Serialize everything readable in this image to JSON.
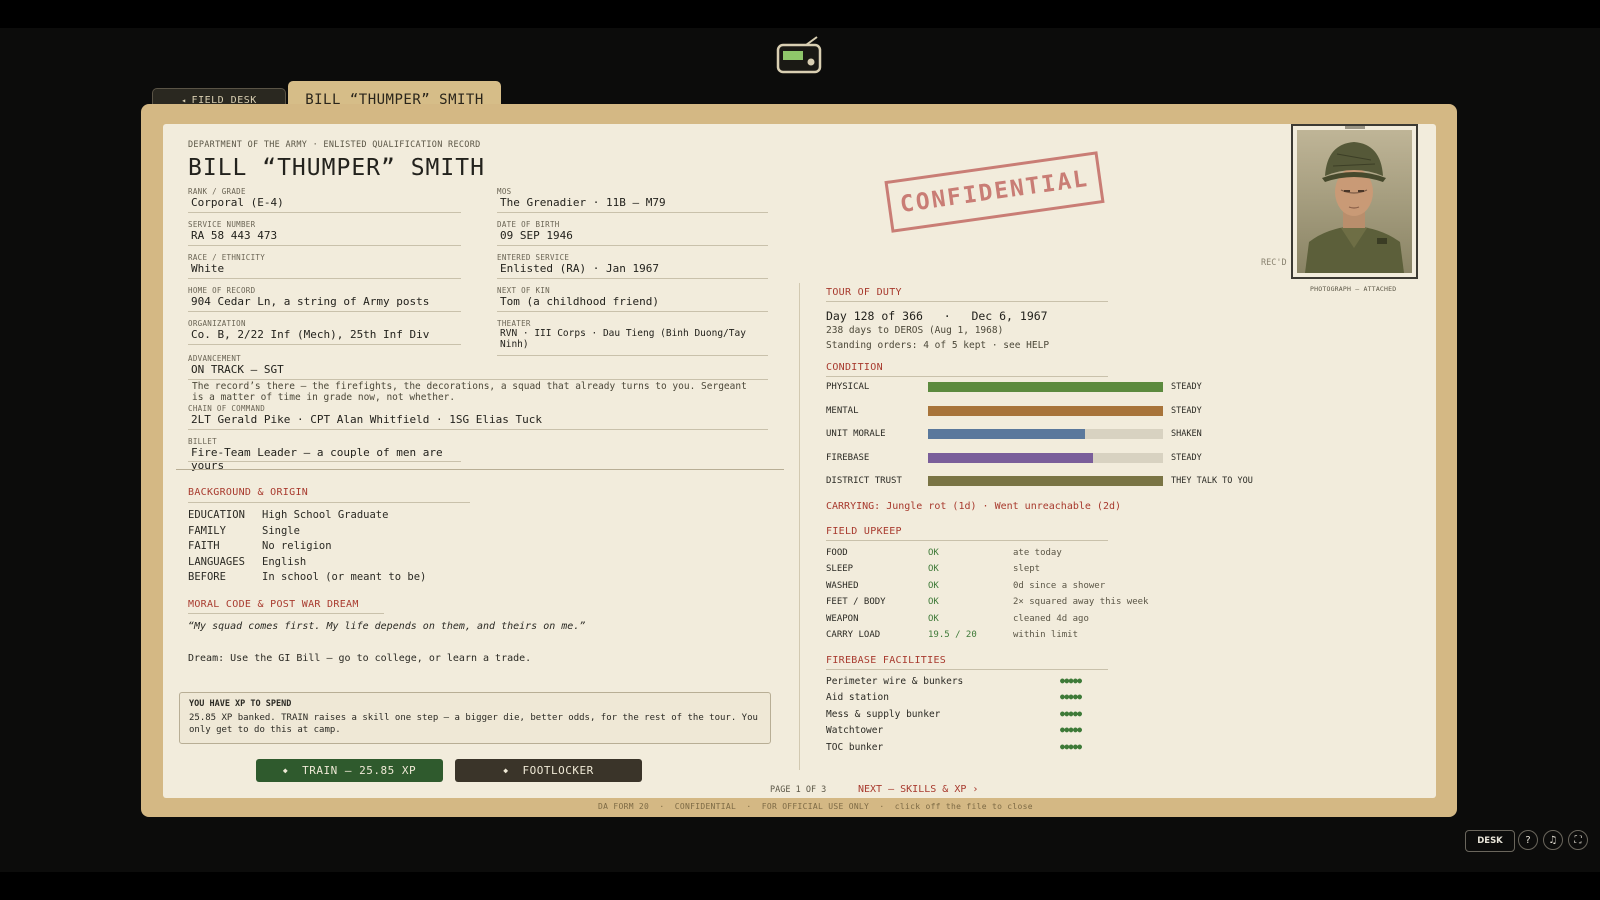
{
  "tabs": {
    "back_label": "FIELD DESK",
    "name_label": "BILL “THUMPER” SMITH"
  },
  "record": {
    "department": "DEPARTMENT OF THE ARMY · ENLISTED QUALIFICATION RECORD",
    "name": "BILL “THUMPER” SMITH",
    "fields": {
      "rank": {
        "label": "RANK / GRADE",
        "value": "Corporal (E-4)"
      },
      "mos": {
        "label": "MOS",
        "value": "The Grenadier · 11B — M79"
      },
      "service_number": {
        "label": "SERVICE NUMBER",
        "value": "RA 58 443 473"
      },
      "dob": {
        "label": "DATE OF BIRTH",
        "value": "09 SEP 1946"
      },
      "race": {
        "label": "RACE / ETHNICITY",
        "value": "White"
      },
      "entered": {
        "label": "ENTERED SERVICE",
        "value": "Enlisted (RA) · Jan 1967"
      },
      "home": {
        "label": "HOME OF RECORD",
        "value": "904 Cedar Ln, a string of Army posts"
      },
      "kin": {
        "label": "NEXT OF KIN",
        "value": "Tom (a childhood friend)"
      },
      "org": {
        "label": "ORGANIZATION",
        "value": "Co. B, 2/22 Inf (Mech), 25th Inf Div"
      },
      "theater": {
        "label": "THEATER",
        "value": "RVN · III Corps · Dau Tieng (Binh Duong/Tay Ninh)"
      },
      "advancement": {
        "label": "ADVANCEMENT",
        "value": "ON TRACK — SGT"
      },
      "chain": {
        "label": "CHAIN OF COMMAND",
        "value": "2LT Gerald Pike · CPT Alan Whitfield · 1SG Elias Tuck"
      },
      "billet": {
        "label": "BILLET",
        "value": "Fire-Team Leader — a couple of men are yours"
      }
    },
    "advancement_note": "The record’s there — the firefights, the decorations, a squad that already turns to you. Sergeant is a matter of time in grade now, not whether."
  },
  "background": {
    "title": "BACKGROUND & ORIGIN",
    "rows": [
      {
        "k": "EDUCATION",
        "v": "High School Graduate"
      },
      {
        "k": "FAMILY",
        "v": "Single"
      },
      {
        "k": "FAITH",
        "v": "No religion"
      },
      {
        "k": "LANGUAGES",
        "v": "English"
      },
      {
        "k": "BEFORE",
        "v": "In school (or meant to be)"
      }
    ]
  },
  "moral": {
    "title": "MORAL CODE & POST WAR DREAM",
    "quote": "“My squad comes first. My life depends on them, and theirs on me.”",
    "dream": "Dream: Use the GI Bill — go to college, or learn a trade."
  },
  "xp": {
    "heading": "YOU HAVE XP TO SPEND",
    "text": "25.85 XP banked. TRAIN raises a skill one step — a bigger die, better odds, for the rest of the tour. You only get to do this at camp."
  },
  "buttons": {
    "train": "TRAIN — 25.85 XP",
    "footlocker": "FOOTLOCKER",
    "diamond": "◆"
  },
  "pager": {
    "page": "PAGE 1 OF 3",
    "next": "NEXT — SKILLS & XP ›"
  },
  "footer": "DA FORM 20  ·  CONFIDENTIAL  ·  FOR OFFICIAL USE ONLY  ·  click off the file to close",
  "stamp": "CONFIDENTIAL",
  "photo": {
    "caption": "PHOTOGRAPH — ATTACHED",
    "recd": "REC'D"
  },
  "tour": {
    "title": "TOUR OF DUTY",
    "day": "Day 128 of 366",
    "date": "Dec 6, 1967",
    "sep": "·",
    "deros": "238 days to DEROS (Aug 1, 1968)",
    "orders": "Standing orders: 4 of 5 kept · see HELP"
  },
  "condition": {
    "title": "CONDITION",
    "rows": [
      {
        "k": "PHYSICAL",
        "status": "STEADY",
        "level": 1.0,
        "color": "#5c8a3e"
      },
      {
        "k": "MENTAL",
        "status": "STEADY",
        "level": 1.0,
        "color": "#a8743a"
      },
      {
        "k": "UNIT MORALE",
        "status": "SHAKEN",
        "level": 0.67,
        "color": "#5a789c"
      },
      {
        "k": "FIREBASE",
        "status": "STEADY",
        "level": 0.7,
        "color": "#7a5e9a"
      },
      {
        "k": "DISTRICT TRUST",
        "status": "THEY TALK TO YOU",
        "level": 1.0,
        "color": "#7a7444"
      }
    ],
    "carrying": "CARRYING: Jungle rot (1d) · Went unreachable (2d)"
  },
  "upkeep": {
    "title": "FIELD UPKEEP",
    "rows": [
      {
        "k": "FOOD",
        "v": "OK",
        "n": "ate today"
      },
      {
        "k": "SLEEP",
        "v": "OK",
        "n": "slept"
      },
      {
        "k": "WASHED",
        "v": "OK",
        "n": "0d since a shower"
      },
      {
        "k": "FEET / BODY",
        "v": "OK",
        "n": "2× squared away this week"
      },
      {
        "k": "WEAPON",
        "v": "OK",
        "n": "cleaned 4d ago"
      },
      {
        "k": "CARRY LOAD",
        "v": "19.5 / 20",
        "n": "within limit"
      }
    ]
  },
  "facilities": {
    "title": "FIREBASE FACILITIES",
    "rows": [
      {
        "k": "Perimeter wire & bunkers",
        "rating": "●●●●●"
      },
      {
        "k": "Aid station",
        "rating": "●●●●●"
      },
      {
        "k": "Mess & supply bunker",
        "rating": "●●●●●"
      },
      {
        "k": "Watchtower",
        "rating": "●●●●●"
      },
      {
        "k": "TOC bunker",
        "rating": "●●●●●"
      }
    ]
  },
  "controls": {
    "desk": "DESK",
    "help": "?",
    "music": "♫",
    "fullscreen": "⛶"
  }
}
